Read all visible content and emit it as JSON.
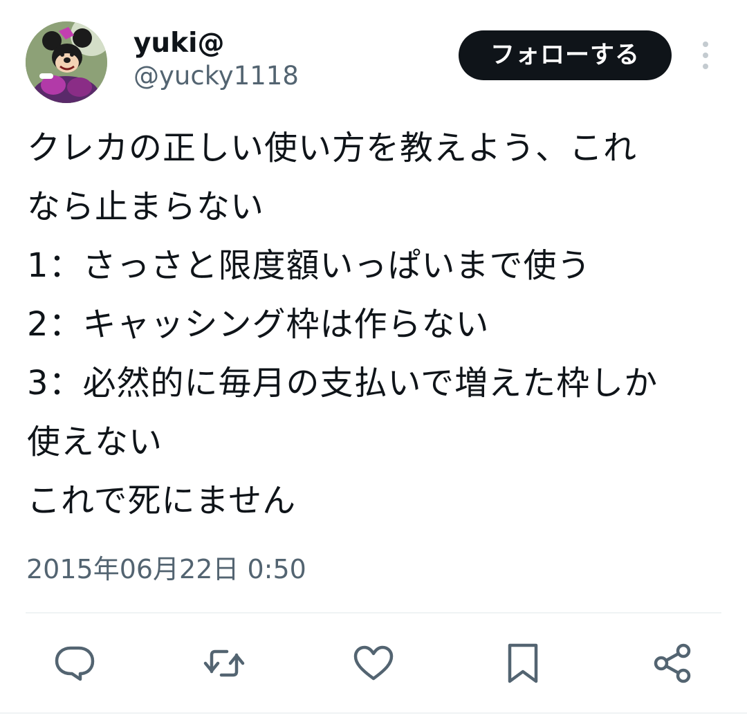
{
  "tweet": {
    "author": {
      "display_name": "yuki@",
      "handle": "@yucky1118",
      "avatar_icon": "avatar-photo"
    },
    "follow_label": "フォローする",
    "more_icon": "more-vertical-icon",
    "text_lines": [
      "クレカの正しい使い方を教えよう、これ",
      "なら止まらない",
      "1：さっさと限度額いっぱいまで使う",
      "2：キャッシング枠は作らない",
      "3：必然的に毎月の支払いで増えた枠しか",
      "使えない",
      "これで死にません"
    ],
    "timestamp": "2015年06月22日 0:50"
  },
  "actions": {
    "reply_icon": "reply-icon",
    "retweet_icon": "retweet-icon",
    "like_icon": "heart-icon",
    "bookmark_icon": "bookmark-icon",
    "share_icon": "share-icon"
  },
  "colors": {
    "text_primary": "#0f1419",
    "text_secondary": "#536471",
    "icon_gray": "#536471",
    "follow_bg": "#0f1419",
    "follow_text": "#ffffff",
    "divider": "#eff3f4"
  }
}
